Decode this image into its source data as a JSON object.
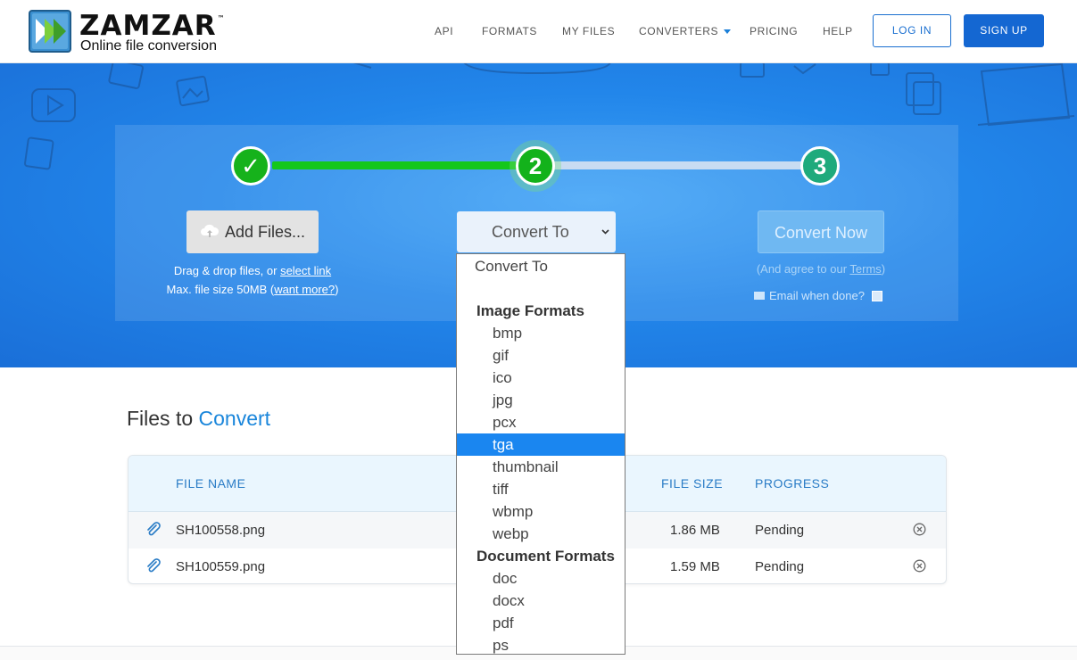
{
  "header": {
    "brand": "ZAMZAR",
    "trademark": "™",
    "tagline": "Online file conversion",
    "nav": [
      "API",
      "FORMATS",
      "MY FILES",
      "CONVERTERS",
      "PRICING",
      "HELP"
    ],
    "login_label": "LOG IN",
    "signup_label": "SIGN UP",
    "colors": {
      "primary": "#1467d2",
      "accent": "#1a86db"
    }
  },
  "steps": {
    "step1_symbol": "✓",
    "step2_label": "2",
    "step3_label": "3",
    "colors": {
      "done": "#14c71b",
      "pending": "#c8dcf2"
    }
  },
  "add_files": {
    "label": "Add Files...",
    "hint_line1_text": "Drag & drop files, or ",
    "hint_line1_link": "select link",
    "hint_line2_text": "Max. file size 50MB (",
    "hint_line2_link": "want more?",
    "hint_line2_suffix": ")"
  },
  "convert_to": {
    "selected": "Convert To",
    "options": [
      {
        "label": "Convert To",
        "kind": "header"
      },
      {
        "label": "",
        "kind": "spacer"
      },
      {
        "label": "Image Formats",
        "kind": "group"
      },
      {
        "label": "bmp",
        "kind": "item"
      },
      {
        "label": "gif",
        "kind": "item"
      },
      {
        "label": "ico",
        "kind": "item"
      },
      {
        "label": "jpg",
        "kind": "item"
      },
      {
        "label": "pcx",
        "kind": "item"
      },
      {
        "label": "tga",
        "kind": "item",
        "highlighted": true
      },
      {
        "label": "thumbnail",
        "kind": "item"
      },
      {
        "label": "tiff",
        "kind": "item"
      },
      {
        "label": "wbmp",
        "kind": "item"
      },
      {
        "label": "webp",
        "kind": "item"
      },
      {
        "label": "Document Formats",
        "kind": "group"
      },
      {
        "label": "doc",
        "kind": "item"
      },
      {
        "label": "docx",
        "kind": "item"
      },
      {
        "label": "pdf",
        "kind": "item"
      },
      {
        "label": "ps",
        "kind": "item"
      }
    ]
  },
  "convert_now": {
    "label": "Convert Now",
    "terms_prefix": "(And agree to our ",
    "terms_link": "Terms",
    "terms_suffix": ")",
    "email_label": "Email when done?"
  },
  "files": {
    "title_prefix": "Files to ",
    "title_accent": "Convert",
    "columns": [
      "FILE NAME",
      "FILE SIZE",
      "PROGRESS"
    ],
    "rows": [
      {
        "name": "SH100558.png",
        "size": "1.86 MB",
        "progress": "Pending"
      },
      {
        "name": "SH100559.png",
        "size": "1.59 MB",
        "progress": "Pending"
      }
    ]
  }
}
